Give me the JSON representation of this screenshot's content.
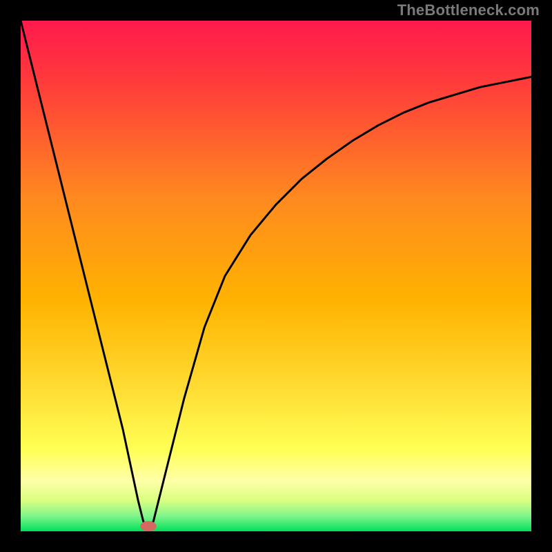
{
  "watermark": "TheBottleneck.com",
  "chart_data": {
    "type": "line",
    "title": "",
    "xlabel": "",
    "ylabel": "",
    "xlim": [
      0,
      100
    ],
    "ylim": [
      0,
      100
    ],
    "grid": false,
    "legend": false,
    "background_gradient": {
      "top": "#ff1a4d",
      "mid": "#ffc400",
      "lower": "#ffff66",
      "bottom": "#00e05a"
    },
    "series": [
      {
        "name": "bottleneck-curve",
        "x": [
          0,
          5,
          10,
          15,
          20,
          23,
          24,
          25,
          26,
          27,
          29,
          32,
          36,
          40,
          45,
          50,
          55,
          60,
          65,
          70,
          75,
          80,
          85,
          90,
          95,
          100
        ],
        "values": [
          100,
          80,
          60,
          40,
          20,
          6,
          2,
          0,
          2,
          6,
          14,
          26,
          40,
          50,
          58,
          64,
          69,
          73,
          76.5,
          79.5,
          82,
          84,
          85.5,
          87,
          88,
          89
        ]
      }
    ],
    "marker": {
      "name": "optimal-point",
      "x": 25,
      "y": 1,
      "rx": 1.6,
      "ry": 1.0,
      "color": "#d46a5f"
    }
  }
}
